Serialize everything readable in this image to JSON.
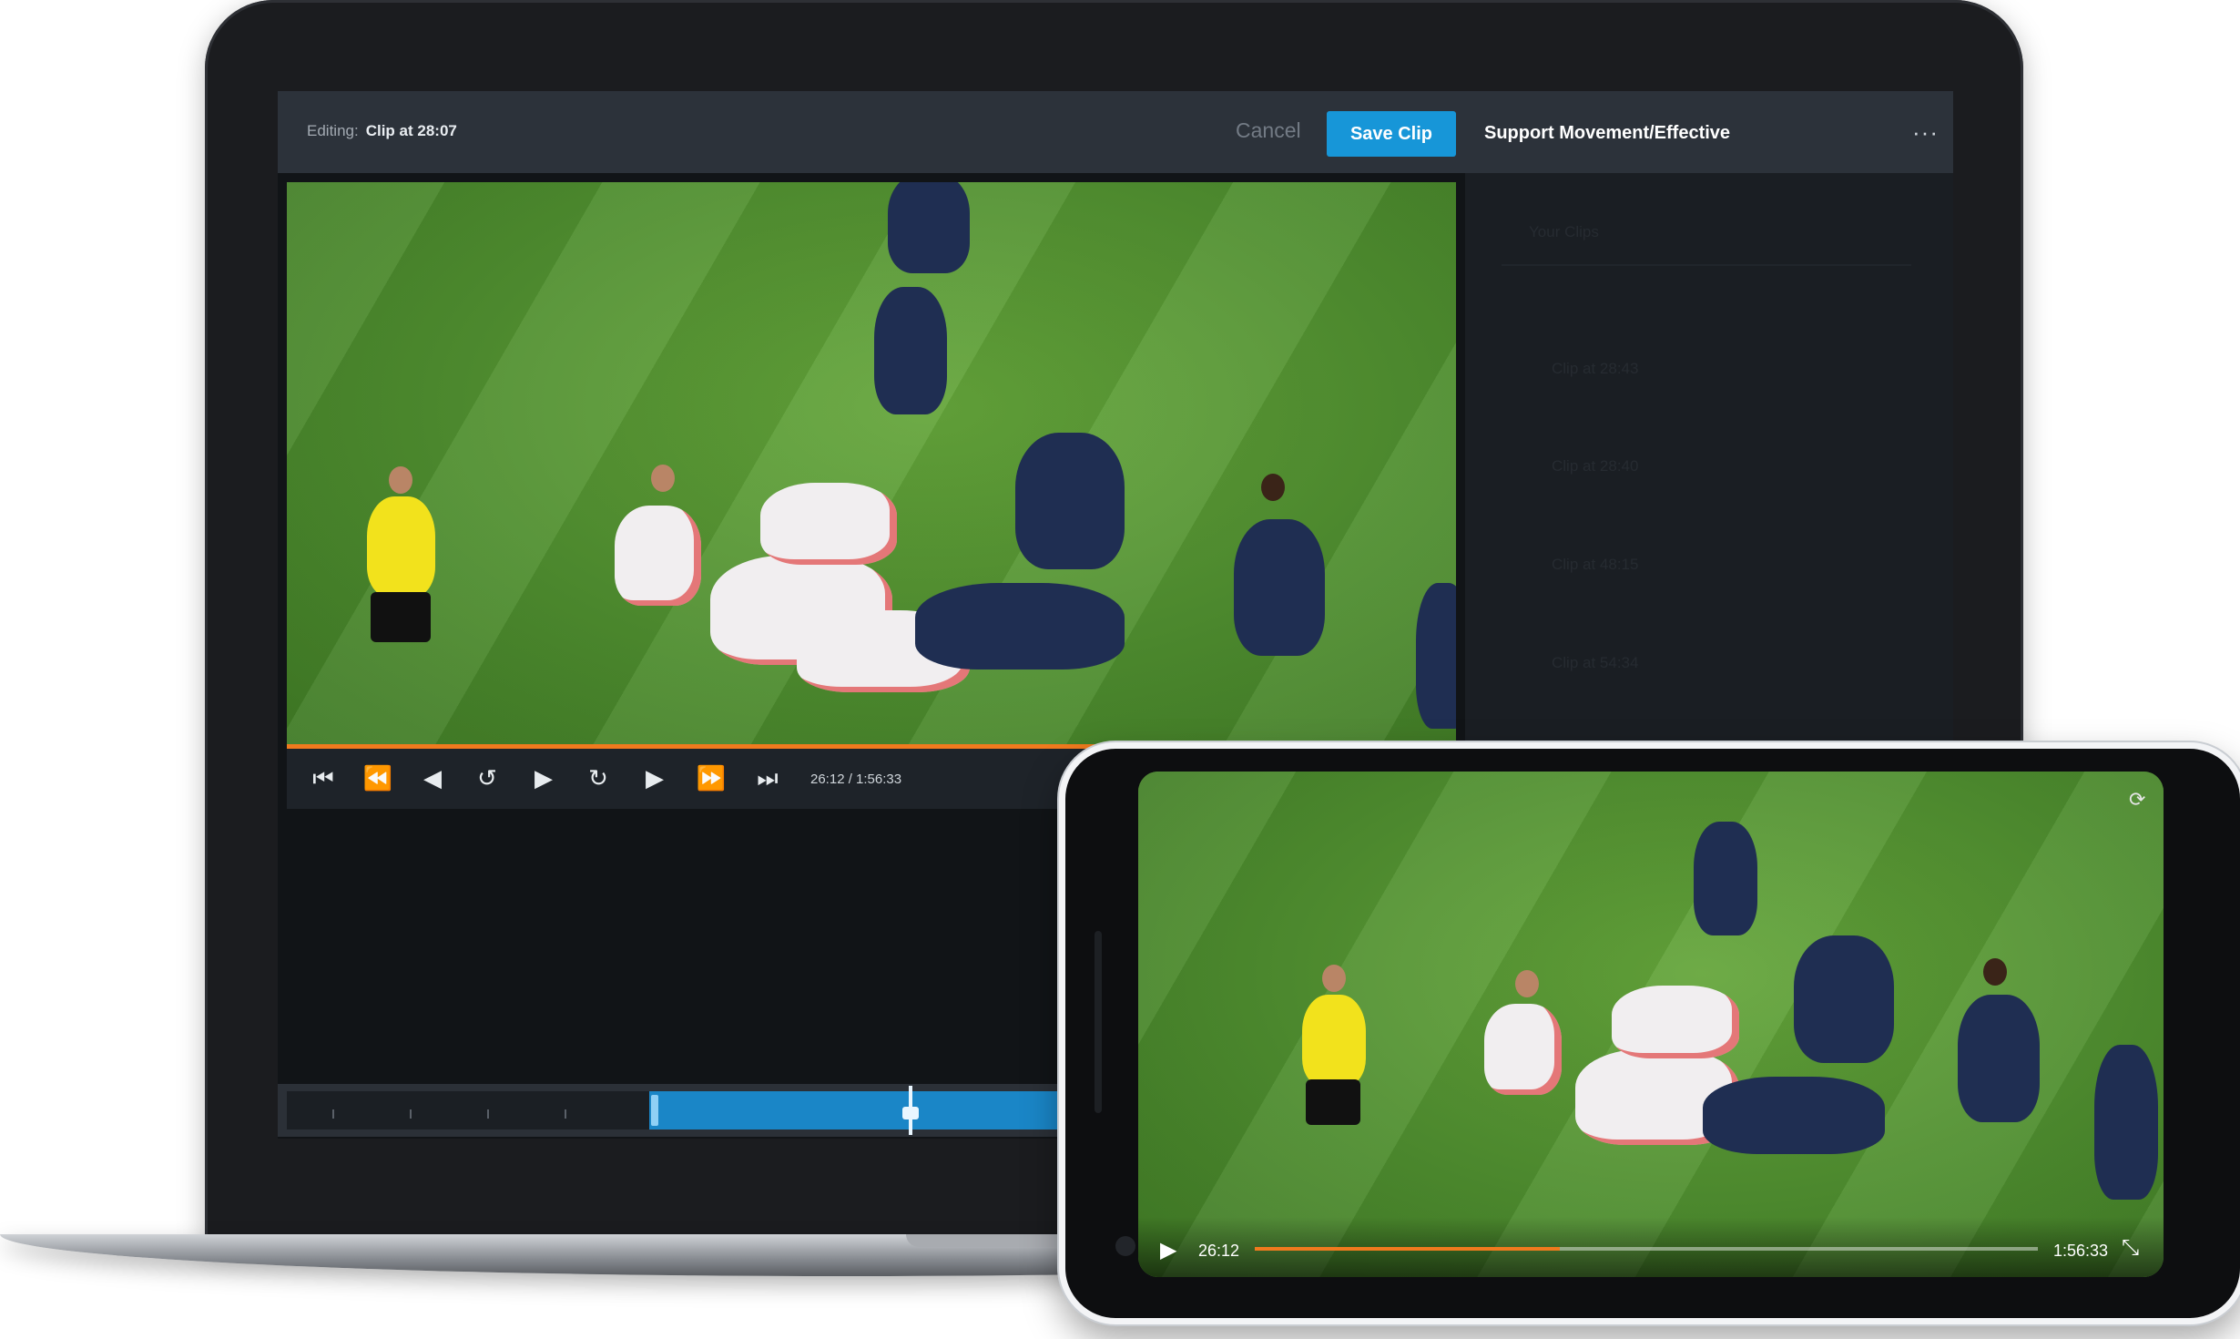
{
  "editor": {
    "editing_label": "Editing:",
    "clip_title": "Clip at 28:07",
    "cancel_label": "Cancel",
    "save_label": "Save Clip",
    "panel_title": "Support Movement/Effective",
    "more_label": "···"
  },
  "player": {
    "time": "26:12 / 1:56:33",
    "controls": [
      {
        "name": "skip-to-start",
        "glyph": "⏮"
      },
      {
        "name": "rewind",
        "glyph": "⏪"
      },
      {
        "name": "step-back",
        "glyph": "◀"
      },
      {
        "name": "back-5",
        "glyph": "↺"
      },
      {
        "name": "play",
        "glyph": "▶"
      },
      {
        "name": "forward-5",
        "glyph": "↻"
      },
      {
        "name": "step-forward",
        "glyph": "▶"
      },
      {
        "name": "fast-forward",
        "glyph": "⏩"
      },
      {
        "name": "skip-to-end",
        "glyph": "⏭"
      }
    ]
  },
  "clips_panel": {
    "heading": "Your Clips",
    "items": [
      "Clip at 28:43",
      "Clip at 28:40",
      "Clip at 48:15",
      "Clip at 54:34"
    ]
  },
  "phone": {
    "current": "26:12",
    "duration": "1:56:33",
    "progress": 0.39,
    "play_glyph": "▶",
    "exit_fullscreen_glyph": "⤡",
    "rotate_glyph": "⟳"
  },
  "colors": {
    "accent": "#1796d8",
    "progress": "#f07a1e",
    "pitch": "#4e8a2d"
  }
}
